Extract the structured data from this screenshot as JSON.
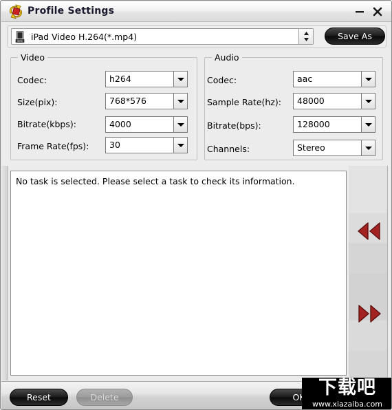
{
  "window": {
    "title": "Profile Settings",
    "icon": "convert-icon",
    "minimize_label": "−",
    "close_label": "✕"
  },
  "profile": {
    "selected": "iPad Video H.264(*.mp4)",
    "icon": "ipad-mp4-icon",
    "save_as_label": "Save As"
  },
  "video": {
    "title": "Video",
    "fields": [
      {
        "label": "Codec:",
        "value": "h264"
      },
      {
        "label": "Size(pix):",
        "value": "768*576"
      },
      {
        "label": "Bitrate(kbps):",
        "value": "4000"
      },
      {
        "label": "Frame Rate(fps):",
        "value": "30"
      }
    ]
  },
  "audio": {
    "title": "Audio",
    "fields": [
      {
        "label": "Codec:",
        "value": "aac"
      },
      {
        "label": "Sample Rate(hz):",
        "value": "48000"
      },
      {
        "label": "Bitrate(bps):",
        "value": "128000"
      },
      {
        "label": "Channels:",
        "value": "Stereo"
      }
    ]
  },
  "info": {
    "message": "No task is selected. Please select a task to check its information."
  },
  "nav": {
    "prev_icon": "double-arrow-left-icon",
    "next_icon": "double-arrow-right-icon",
    "arrow_color": "#a32323"
  },
  "footer": {
    "reset_label": "Reset",
    "delete_label": "Delete",
    "ok_label": "OK"
  },
  "watermark": {
    "cn": "下载吧",
    "url": "www.xiazaiba.com"
  }
}
